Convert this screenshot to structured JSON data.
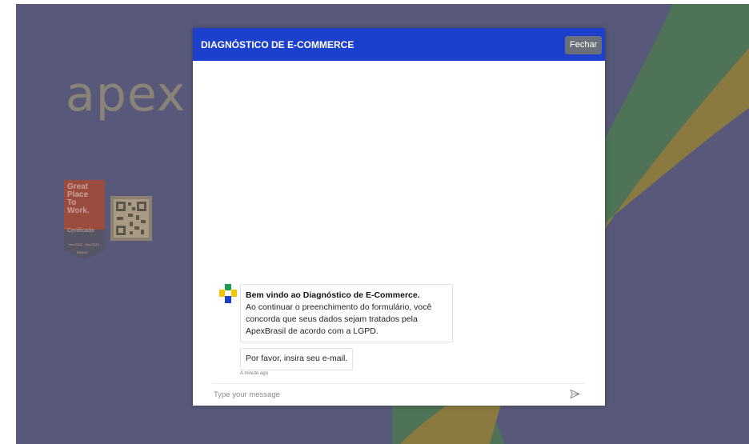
{
  "background": {
    "logo_text": "apex",
    "gptw_badge": {
      "line1": "Great",
      "line2": "Place",
      "line3": "To",
      "line4": "Work.",
      "certified": "Certificado",
      "period": "Nov/2022 - Nov/2023",
      "country": "BRASIL"
    },
    "qr_code_icon": "qr-code-icon"
  },
  "chat": {
    "title": "DIAGNÓSTICO DE E-COMMERCE",
    "close_label": "Fechar",
    "messages": [
      {
        "bold": "Bem vindo ao Diagnóstico de E-Commerce.",
        "text": "Ao continuar o preenchimento do formulário, você concorda que seus dados sejam tratados pela ApexBrasil de acordo com a LGPD."
      },
      {
        "text": "Por favor, insira seu e-mail."
      }
    ],
    "timestamp": "A minute ago",
    "input_placeholder": "Type your message",
    "send_icon": "send-icon"
  },
  "colors": {
    "header": "#1c3fcc",
    "backdrop": "#58597a",
    "close_button": "#6b6f7a"
  }
}
